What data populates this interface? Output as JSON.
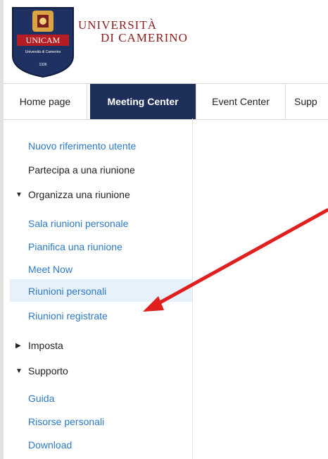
{
  "header": {
    "crest_text": "UNICAM",
    "crest_subtext": "Università di Camerino",
    "crest_year": "1336",
    "name_line1": "UNIVERSITÀ",
    "name_line2": "DI CAMERINO"
  },
  "tabs": [
    {
      "label": "Home page"
    },
    {
      "label": "Meeting Center"
    },
    {
      "label": "Event Center"
    },
    {
      "label": "Supp"
    }
  ],
  "sidebar": {
    "items": [
      {
        "label": "Nuovo riferimento utente"
      },
      {
        "label": "Partecipa a una riunione"
      },
      {
        "label": "Organizza una riunione",
        "expanded": true
      },
      {
        "label": "Sala riunioni personale"
      },
      {
        "label": "Pianifica una riunione"
      },
      {
        "label": "Meet Now"
      },
      {
        "label": "Riunioni personali"
      },
      {
        "label": "Riunioni registrate"
      },
      {
        "label": "Imposta",
        "expanded": false
      },
      {
        "label": "Supporto",
        "expanded": true
      },
      {
        "label": "Guida"
      },
      {
        "label": "Risorse personali"
      },
      {
        "label": "Download"
      }
    ]
  },
  "colors": {
    "active_tab": "#1e2f5a",
    "link_blue": "#2d79c7",
    "brand_red": "#8a1c1c",
    "arrow": "#e01f1f",
    "highlight": "#e6f1fb"
  }
}
